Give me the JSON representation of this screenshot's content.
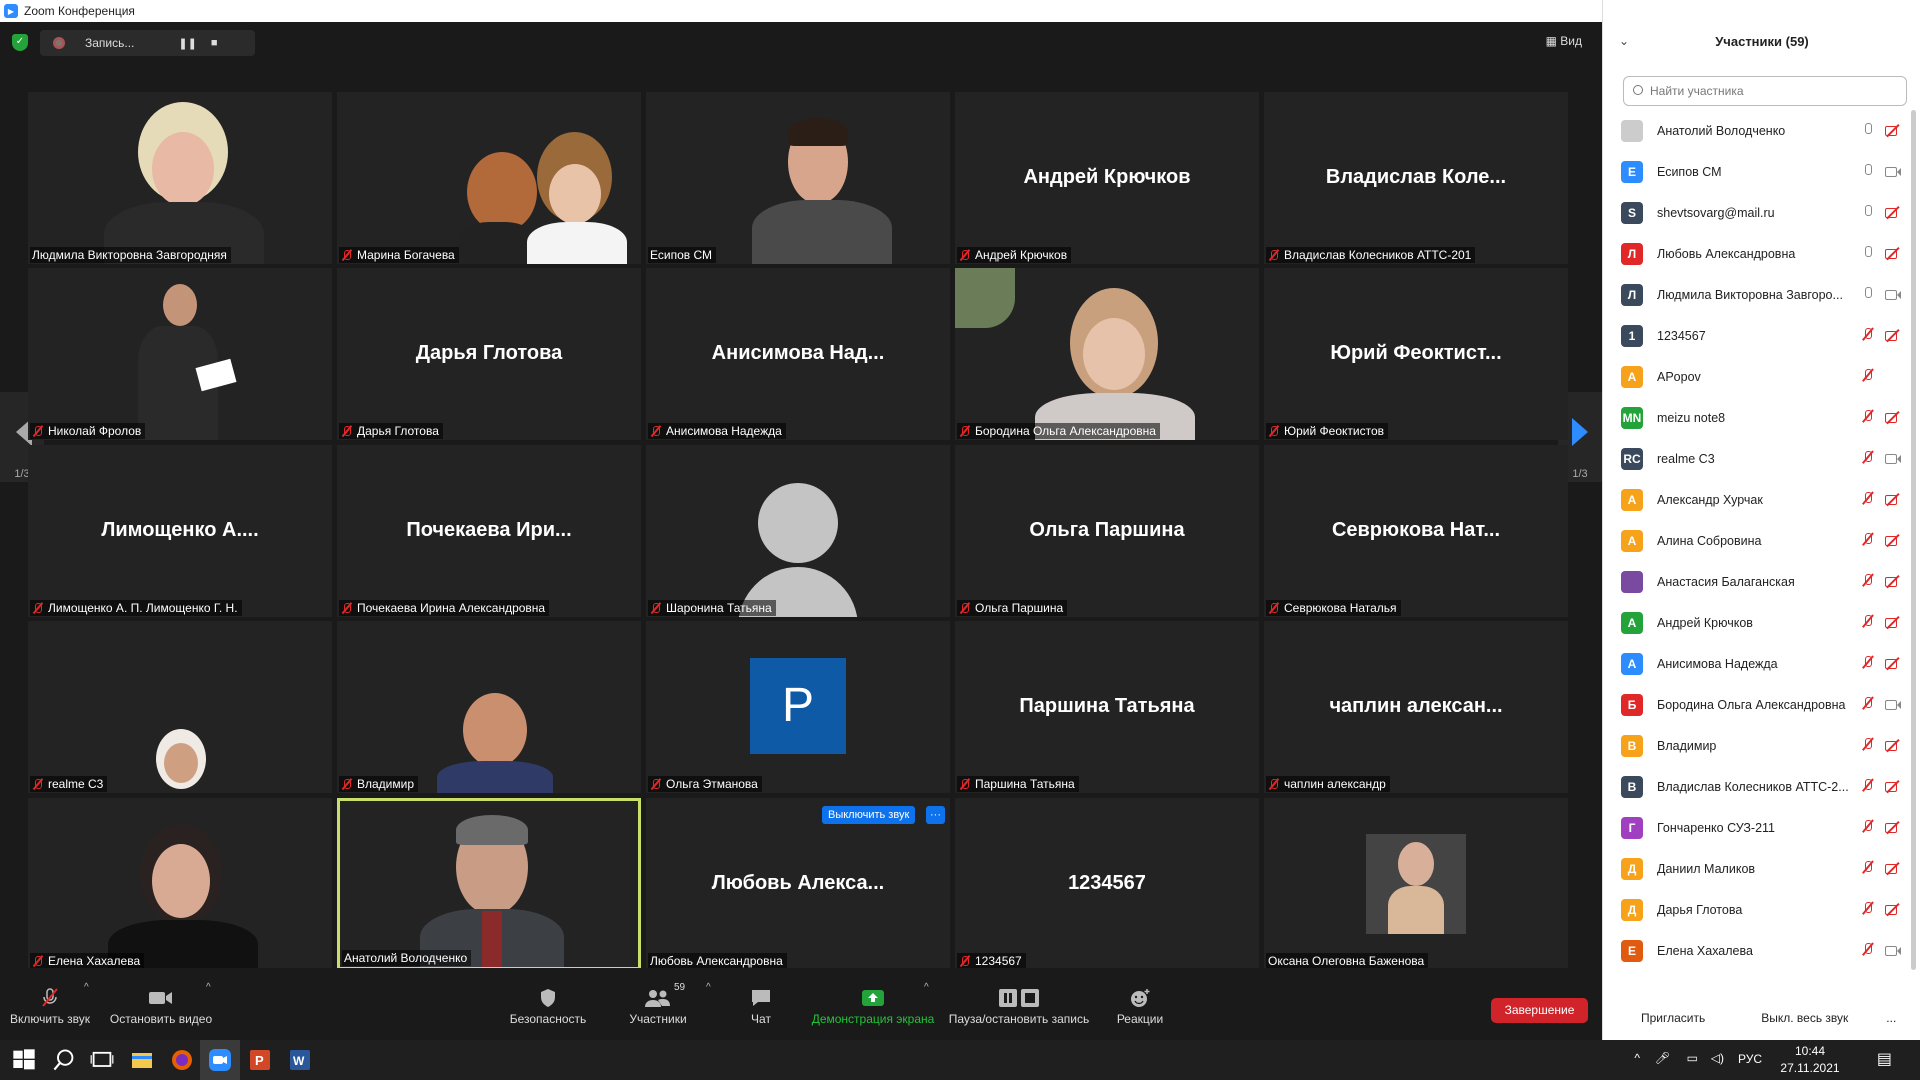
{
  "window": {
    "title": "Zoom Конференция"
  },
  "topbar": {
    "recording_label": "Запись...",
    "view_label": "Вид"
  },
  "nav": {
    "page_indicator_left": "1/3",
    "page_indicator_right": "1/3"
  },
  "tiles": [
    {
      "big": "",
      "caption": "Людмила Викторовна Завгородняя",
      "muted": false,
      "video": "lady-blonde"
    },
    {
      "big": "",
      "caption": "Марина Богачева",
      "muted": true,
      "video": "two-girls"
    },
    {
      "big": "",
      "caption": "Есипов СМ",
      "muted": false,
      "video": "young-man"
    },
    {
      "big": "Андрей Крючков",
      "caption": "Андрей Крючков",
      "muted": true,
      "video": ""
    },
    {
      "big": "Владислав  Коле...",
      "caption": "Владислав Колесников АТТС-201",
      "muted": true,
      "video": ""
    },
    {
      "big": "",
      "caption": "Николай Фролов",
      "muted": true,
      "video": "standing-man"
    },
    {
      "big": "Дарья Глотова",
      "caption": "Дарья Глотова",
      "muted": true,
      "video": ""
    },
    {
      "big": "Анисимова  Над...",
      "caption": "Анисимова Надежда",
      "muted": true,
      "video": ""
    },
    {
      "big": "",
      "caption": "Бородина Ольга Александровна",
      "muted": true,
      "video": "woman-plant"
    },
    {
      "big": "Юрий  Феоктист...",
      "caption": "Юрий Феоктистов",
      "muted": true,
      "video": ""
    },
    {
      "big": "Лимощенко  А....",
      "caption": "Лимощенко А. П. Лимощенко Г. Н.",
      "muted": true,
      "video": ""
    },
    {
      "big": "Почекаева  Ири...",
      "caption": "Почекаева Ирина Александровна",
      "muted": true,
      "video": ""
    },
    {
      "big": "",
      "caption": "Шаронина Татьяна",
      "muted": true,
      "video": "placeholder"
    },
    {
      "big": "Ольга Паршина",
      "caption": "Ольга Паршина",
      "muted": true,
      "video": ""
    },
    {
      "big": "Севрюкова  Нат...",
      "caption": "Севрюкова Наталья",
      "muted": true,
      "video": ""
    },
    {
      "big": "",
      "caption": "realme C3",
      "muted": true,
      "video": "woman-scarf"
    },
    {
      "big": "",
      "caption": "Владимир",
      "muted": true,
      "video": "man-wall"
    },
    {
      "big": "",
      "caption": "Ольга Этманова",
      "muted": true,
      "video": "p-avatar"
    },
    {
      "big": "Паршина Татьяна",
      "caption": "Паршина Татьяна",
      "muted": true,
      "video": ""
    },
    {
      "big": "чаплин  алексан...",
      "caption": "чаплин александр",
      "muted": true,
      "video": ""
    },
    {
      "big": "",
      "caption": "Елена Хахалева",
      "muted": true,
      "video": "woman-dark"
    },
    {
      "big": "",
      "caption": "Анатолий Володченко",
      "muted": false,
      "video": "man-suit"
    },
    {
      "big": "Любовь  Алекса...",
      "caption": "Любовь Александровна",
      "muted": false,
      "video": ""
    },
    {
      "big": "1234567",
      "caption": "1234567",
      "muted": true,
      "video": ""
    },
    {
      "big": "",
      "caption": "Оксана Олеговна Баженова",
      "muted": false,
      "video": "woman-photo"
    }
  ],
  "tile_actions": {
    "mute_label": "Выключить звук",
    "more_label": "···",
    "p_letter": "P"
  },
  "toolbar": {
    "unmute": "Включить звук",
    "stop_video": "Остановить видео",
    "security": "Безопасность",
    "participants": "Участники",
    "participants_count": "59",
    "chat": "Чат",
    "share": "Демонстрация экрана",
    "pause_record": "Пауза/остановить запись",
    "reactions": "Реакции",
    "end": "Завершение"
  },
  "panel": {
    "title": "Участники (59)",
    "search_placeholder": "Найти участника",
    "invite": "Пригласить",
    "mute_all": "Выкл. весь звук",
    "more": "...",
    "participants": [
      {
        "initial": "",
        "name": "Анатолий Володченко",
        "color": "#cccccc",
        "mic": "on",
        "cam": "off",
        "photo": true
      },
      {
        "initial": "Е",
        "name": "Есипов СМ",
        "color": "#2d8cff",
        "mic": "on",
        "cam": "on"
      },
      {
        "initial": "S",
        "name": "shevtsovarg@mail.ru",
        "color": "#3a4a5c",
        "mic": "on",
        "cam": "off"
      },
      {
        "initial": "Л",
        "name": "Любовь Александровна",
        "color": "#e02828",
        "mic": "on",
        "cam": "off"
      },
      {
        "initial": "Л",
        "name": "Людмила Викторовна Завгоро...",
        "color": "#3a4a5c",
        "mic": "on",
        "cam": "on"
      },
      {
        "initial": "1",
        "name": "1234567",
        "color": "#3a4a5c",
        "mic": "off",
        "cam": "off"
      },
      {
        "initial": "A",
        "name": "APopov",
        "color": "#f7a21b",
        "mic": "off",
        "cam": "none"
      },
      {
        "initial": "MN",
        "name": "meizu note8",
        "color": "#23a33a",
        "mic": "off",
        "cam": "off"
      },
      {
        "initial": "RC",
        "name": "realme C3",
        "color": "#3a4a5c",
        "mic": "off",
        "cam": "on"
      },
      {
        "initial": "А",
        "name": "Александр Хурчак",
        "color": "#f7a21b",
        "mic": "off",
        "cam": "off"
      },
      {
        "initial": "А",
        "name": "Алина Собровина",
        "color": "#f7a21b",
        "mic": "off",
        "cam": "off"
      },
      {
        "initial": "",
        "name": "Анастасия Балаганская",
        "color": "#7a4aa0",
        "mic": "off",
        "cam": "off",
        "photo": true
      },
      {
        "initial": "А",
        "name": "Андрей Крючков",
        "color": "#23a33a",
        "mic": "off",
        "cam": "off"
      },
      {
        "initial": "А",
        "name": "Анисимова Надежда",
        "color": "#2d8cff",
        "mic": "off",
        "cam": "off"
      },
      {
        "initial": "Б",
        "name": "Бородина Ольга Александровна",
        "color": "#e02828",
        "mic": "off",
        "cam": "on"
      },
      {
        "initial": "В",
        "name": "Владимир",
        "color": "#f7a21b",
        "mic": "off",
        "cam": "off"
      },
      {
        "initial": "В",
        "name": "Владислав Колесников АТТС-2...",
        "color": "#3a4a5c",
        "mic": "off",
        "cam": "off"
      },
      {
        "initial": "Г",
        "name": "Гончаренко СУЗ-211",
        "color": "#a040c0",
        "mic": "off",
        "cam": "off"
      },
      {
        "initial": "Д",
        "name": "Даниил Маликов",
        "color": "#f7a21b",
        "mic": "off",
        "cam": "off"
      },
      {
        "initial": "Д",
        "name": "Дарья Глотова",
        "color": "#f7a21b",
        "mic": "off",
        "cam": "off"
      },
      {
        "initial": "Е",
        "name": "Елена Хахалева",
        "color": "#e05a10",
        "mic": "off",
        "cam": "on"
      }
    ]
  },
  "taskbar": {
    "lang": "РУС",
    "time": "10:44",
    "date": "27.11.2021"
  }
}
